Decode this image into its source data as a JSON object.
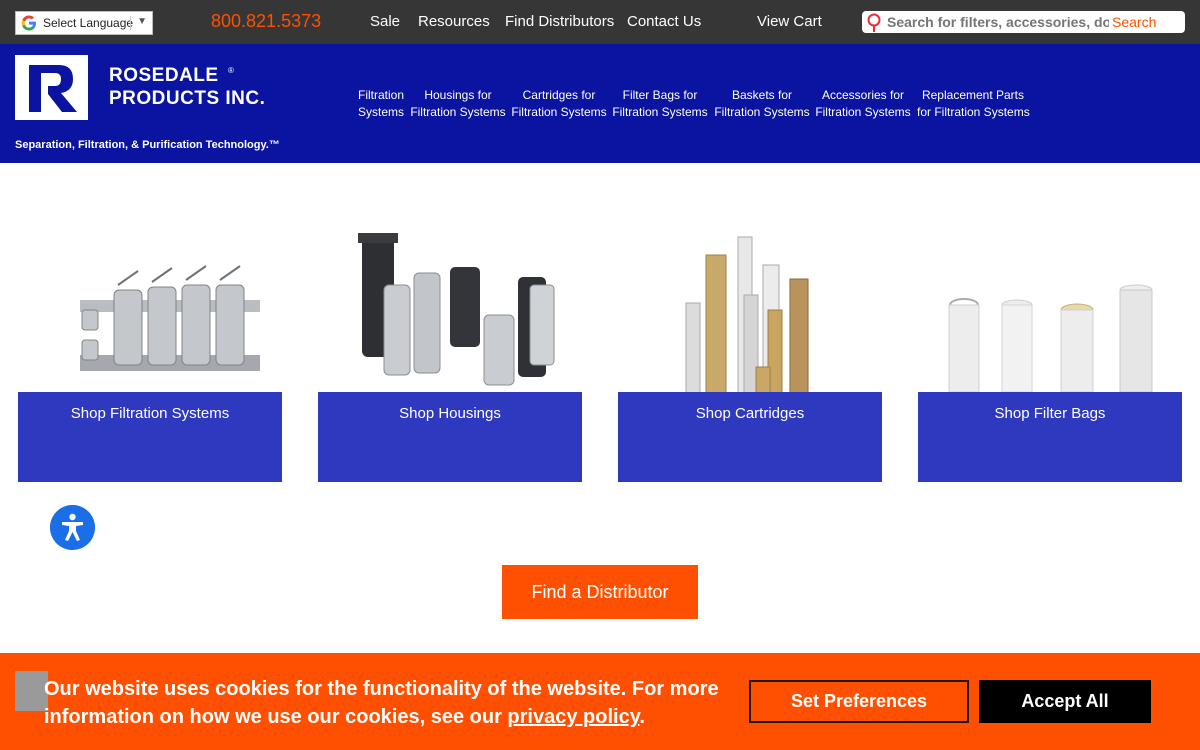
{
  "topbar": {
    "language_label": "Select Language",
    "phone": "800.821.5373",
    "links": [
      "Sale",
      "Resources",
      "Find Distributors",
      "Contact Us"
    ],
    "cart": "View Cart",
    "search_placeholder": "Search for filters, accessories, docs",
    "search_button": "Search"
  },
  "header": {
    "brand_line1": "ROSEDALE",
    "brand_line2": "PRODUCTS INC.",
    "reg": "®",
    "tagline": "Separation, Filtration, & Purification Technology.™",
    "nav": [
      {
        "line1": "Filtration",
        "line2": "Systems"
      },
      {
        "line1": "Housings for",
        "line2": "Filtration Systems"
      },
      {
        "line1": "Cartridges for",
        "line2": "Filtration Systems"
      },
      {
        "line1": "Filter Bags for",
        "line2": "Filtration Systems"
      },
      {
        "line1": "Baskets for",
        "line2": "Filtration Systems"
      },
      {
        "line1": "Accessories for",
        "line2": "Filtration Systems"
      },
      {
        "line1": "Replacement Parts",
        "line2": "for Filtration Systems"
      }
    ]
  },
  "categories": [
    {
      "label": "Shop Filtration Systems"
    },
    {
      "label": "Shop Housings"
    },
    {
      "label": "Shop Cartridges"
    },
    {
      "label": "Shop Filter Bags"
    }
  ],
  "distributor_button": "Find a Distributor",
  "cookie": {
    "text_before": "Our website uses cookies for the functionality of the website. For more information on how we use our cookies, see our ",
    "link": "privacy policy",
    "text_after": ".",
    "preferences": "Set Preferences",
    "accept": "Accept All"
  },
  "colors": {
    "accent": "#fe5000",
    "brand_blue": "#0a14a0",
    "topbar": "#363636"
  }
}
